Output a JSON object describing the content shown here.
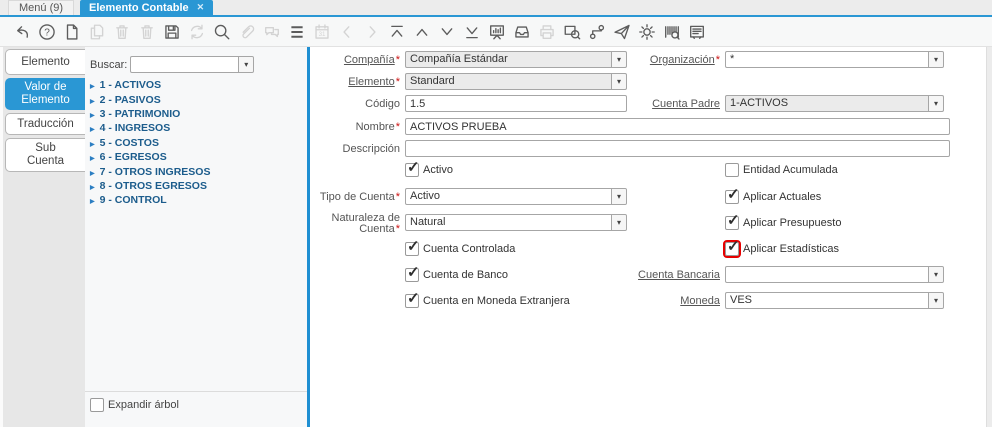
{
  "colors": {
    "accent": "#2a97d4",
    "divider_blue": "#1f8fd2",
    "highlight_red": "#e60000"
  },
  "window": {
    "tabs": [
      {
        "name": "menu-tab",
        "label": "Menú (9)"
      },
      {
        "name": "elemento-contable-tab",
        "label": "Elemento Contable",
        "active": true,
        "close_glyph": "✕"
      }
    ]
  },
  "toolbar": {
    "icons": [
      {
        "name": "undo",
        "enabled": true
      },
      {
        "name": "help",
        "enabled": true
      },
      {
        "name": "new-record",
        "enabled": true
      },
      {
        "name": "copy-record",
        "enabled": false
      },
      {
        "name": "delete-record",
        "enabled": false
      },
      {
        "name": "delete-selection",
        "enabled": false
      },
      {
        "name": "save",
        "enabled": true
      },
      {
        "name": "refresh",
        "enabled": false
      },
      {
        "name": "find",
        "enabled": true
      },
      {
        "name": "attachment",
        "enabled": false
      },
      {
        "name": "chat",
        "enabled": false
      },
      {
        "name": "menu-lines",
        "enabled": true
      },
      {
        "name": "calendar",
        "enabled": false
      },
      {
        "name": "parent-record",
        "enabled": false
      },
      {
        "name": "detail-record",
        "enabled": false
      },
      {
        "name": "first-record",
        "enabled": true
      },
      {
        "name": "previous-record",
        "enabled": true
      },
      {
        "name": "next-record",
        "enabled": true
      },
      {
        "name": "last-record",
        "enabled": true
      },
      {
        "name": "report",
        "enabled": true
      },
      {
        "name": "archive",
        "enabled": true
      },
      {
        "name": "print",
        "enabled": false
      },
      {
        "name": "zoom-across",
        "enabled": true
      },
      {
        "name": "workflow",
        "enabled": true
      },
      {
        "name": "send-request",
        "enabled": true
      },
      {
        "name": "preferences",
        "enabled": true
      },
      {
        "name": "barcode-scan",
        "enabled": true
      },
      {
        "name": "window-log",
        "enabled": true
      }
    ]
  },
  "side_tabs": [
    {
      "name": "tab-elemento",
      "lines": [
        "Elemento"
      ],
      "active": false
    },
    {
      "name": "tab-valor-de-elemento",
      "lines": [
        "Valor de",
        "Elemento"
      ],
      "active": true
    },
    {
      "name": "tab-traduccion",
      "lines": [
        "Traducción"
      ],
      "active": false
    },
    {
      "name": "tab-sub-cuenta",
      "lines": [
        "Sub",
        "Cuenta"
      ],
      "active": false
    }
  ],
  "tree": {
    "search_label": "Buscar:",
    "search_value": "",
    "items": [
      "1 - ACTIVOS",
      "2 - PASIVOS",
      "3 - PATRIMONIO",
      "4 - INGRESOS",
      "5 - COSTOS",
      "6 - EGRESOS",
      "7 - OTROS INGRESOS",
      "8 - OTROS EGRESOS",
      "9 - CONTROL"
    ],
    "expand": {
      "label": "Expandir árbol",
      "checked": false
    }
  },
  "form": {
    "compania": {
      "label": "Compañía",
      "star": "*",
      "value": "Compañía Estándar"
    },
    "organizacion": {
      "label": "Organización",
      "star": "*",
      "value": "*"
    },
    "elemento": {
      "label": "Elemento",
      "star": "*",
      "value": "Standard"
    },
    "codigo": {
      "label": "Código",
      "star": "",
      "value": "1.5"
    },
    "cuenta_padre": {
      "label": "Cuenta Padre",
      "star": "",
      "value": "1-ACTIVOS"
    },
    "nombre": {
      "label": "Nombre",
      "star": "*",
      "value": "ACTIVOS PRUEBA"
    },
    "descripcion": {
      "label": "Descripción",
      "star": "",
      "value": ""
    },
    "activo": {
      "label": "Activo",
      "checked": true
    },
    "entidad_acumulada": {
      "label": "Entidad Acumulada",
      "checked": false
    },
    "tipo_cuenta": {
      "label": "Tipo de Cuenta",
      "star": "*",
      "value": "Activo"
    },
    "aplicar_actuales": {
      "label": "Aplicar Actuales",
      "checked": true
    },
    "naturaleza_cuenta": {
      "label": "Naturaleza de Cuenta",
      "star": "*",
      "value": "Natural"
    },
    "aplicar_presupuesto": {
      "label": "Aplicar Presupuesto",
      "checked": true
    },
    "cuenta_controlada": {
      "label": "Cuenta Controlada",
      "checked": true
    },
    "aplicar_estadisticas": {
      "label": "Aplicar Estadísticas",
      "checked": true,
      "highlighted": true
    },
    "cuenta_banco": {
      "label": "Cuenta de Banco",
      "checked": true
    },
    "cuenta_bancaria": {
      "label": "Cuenta Bancaria",
      "star": "",
      "value": ""
    },
    "cuenta_moneda_extranjera": {
      "label": "Cuenta en Moneda Extranjera",
      "checked": true
    },
    "moneda": {
      "label": "Moneda",
      "star": "",
      "value": "VES"
    }
  }
}
